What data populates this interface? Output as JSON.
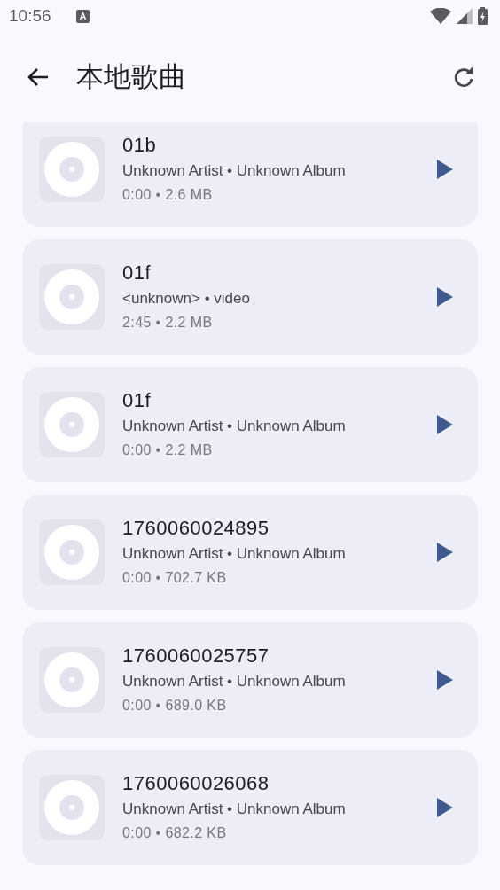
{
  "status_bar": {
    "time": "10:56"
  },
  "app_bar": {
    "title": "本地歌曲"
  },
  "songs": [
    {
      "title": "01b",
      "subtitle": "Unknown Artist • Unknown Album",
      "meta": "0:00 • 2.6 MB"
    },
    {
      "title": "01f",
      "subtitle": "<unknown> • video",
      "meta": "2:45 • 2.2 MB"
    },
    {
      "title": "01f",
      "subtitle": "Unknown Artist • Unknown Album",
      "meta": "0:00 • 2.2 MB"
    },
    {
      "title": "1760060024895",
      "subtitle": "Unknown Artist • Unknown Album",
      "meta": "0:00 • 702.7 KB"
    },
    {
      "title": "1760060025757",
      "subtitle": "Unknown Artist • Unknown Album",
      "meta": "0:00 • 689.0 KB"
    },
    {
      "title": "1760060026068",
      "subtitle": "Unknown Artist • Unknown Album",
      "meta": "0:00 • 682.2 KB"
    }
  ]
}
